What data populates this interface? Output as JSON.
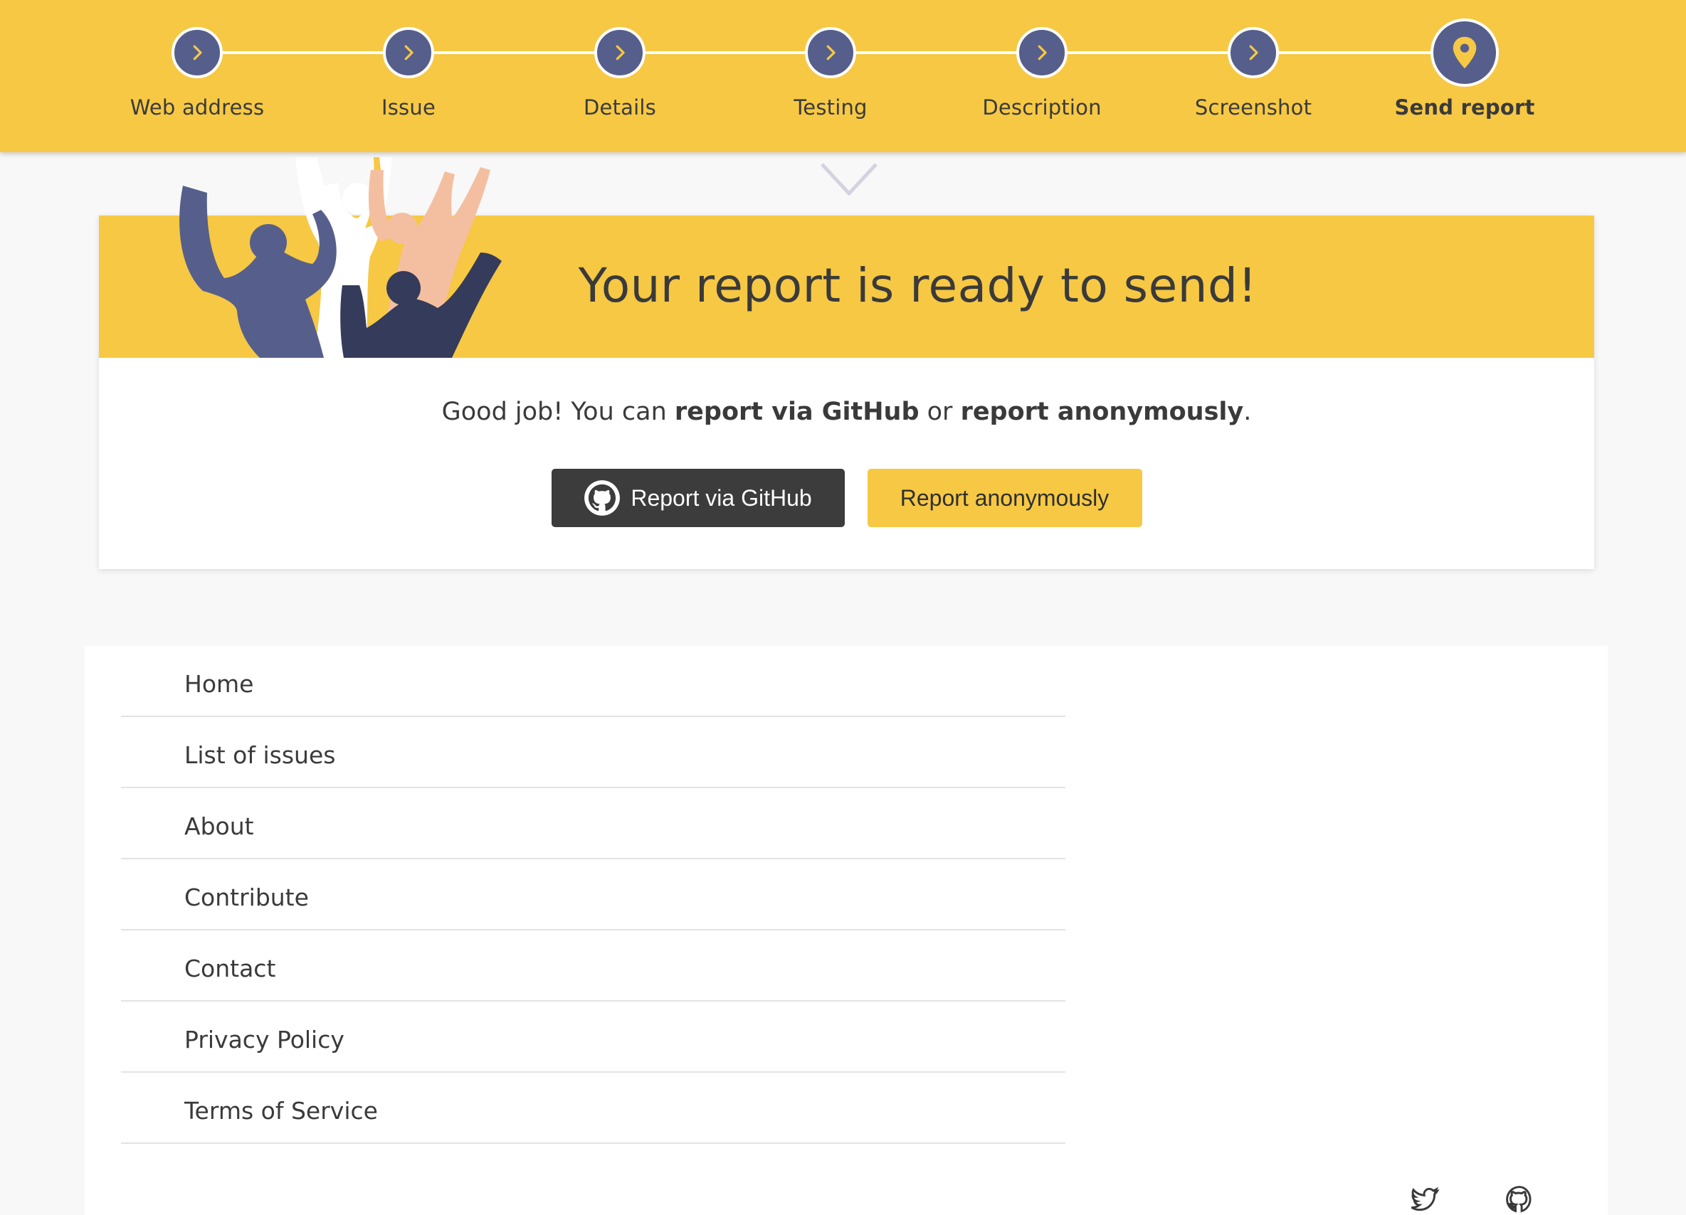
{
  "stepper": {
    "steps": [
      {
        "label": "Web address",
        "icon": "chevron-right-icon",
        "active": false
      },
      {
        "label": "Issue",
        "icon": "chevron-right-icon",
        "active": false
      },
      {
        "label": "Details",
        "icon": "chevron-right-icon",
        "active": false
      },
      {
        "label": "Testing",
        "icon": "chevron-right-icon",
        "active": false
      },
      {
        "label": "Description",
        "icon": "chevron-right-icon",
        "active": false
      },
      {
        "label": "Screenshot",
        "icon": "chevron-right-icon",
        "active": false
      },
      {
        "label": "Send report",
        "icon": "map-pin-icon",
        "active": true
      }
    ]
  },
  "report": {
    "title": "Your report is ready to send!",
    "text_prefix": "Good job! You can ",
    "text_bold_1": "report via GitHub",
    "text_middle": " or ",
    "text_bold_2": "report anonymously",
    "text_suffix": ".",
    "github_button": "Report via GitHub",
    "anonymous_button": "Report anonymously"
  },
  "footer": {
    "links": [
      "Home",
      "List of issues",
      "About",
      "Contribute",
      "Contact",
      "Privacy Policy",
      "Terms of Service"
    ]
  },
  "colors": {
    "brand_yellow": "#f6c844",
    "step_circle": "#565f8b",
    "github_button": "#3c3c3c",
    "text": "#3a3a3a"
  }
}
